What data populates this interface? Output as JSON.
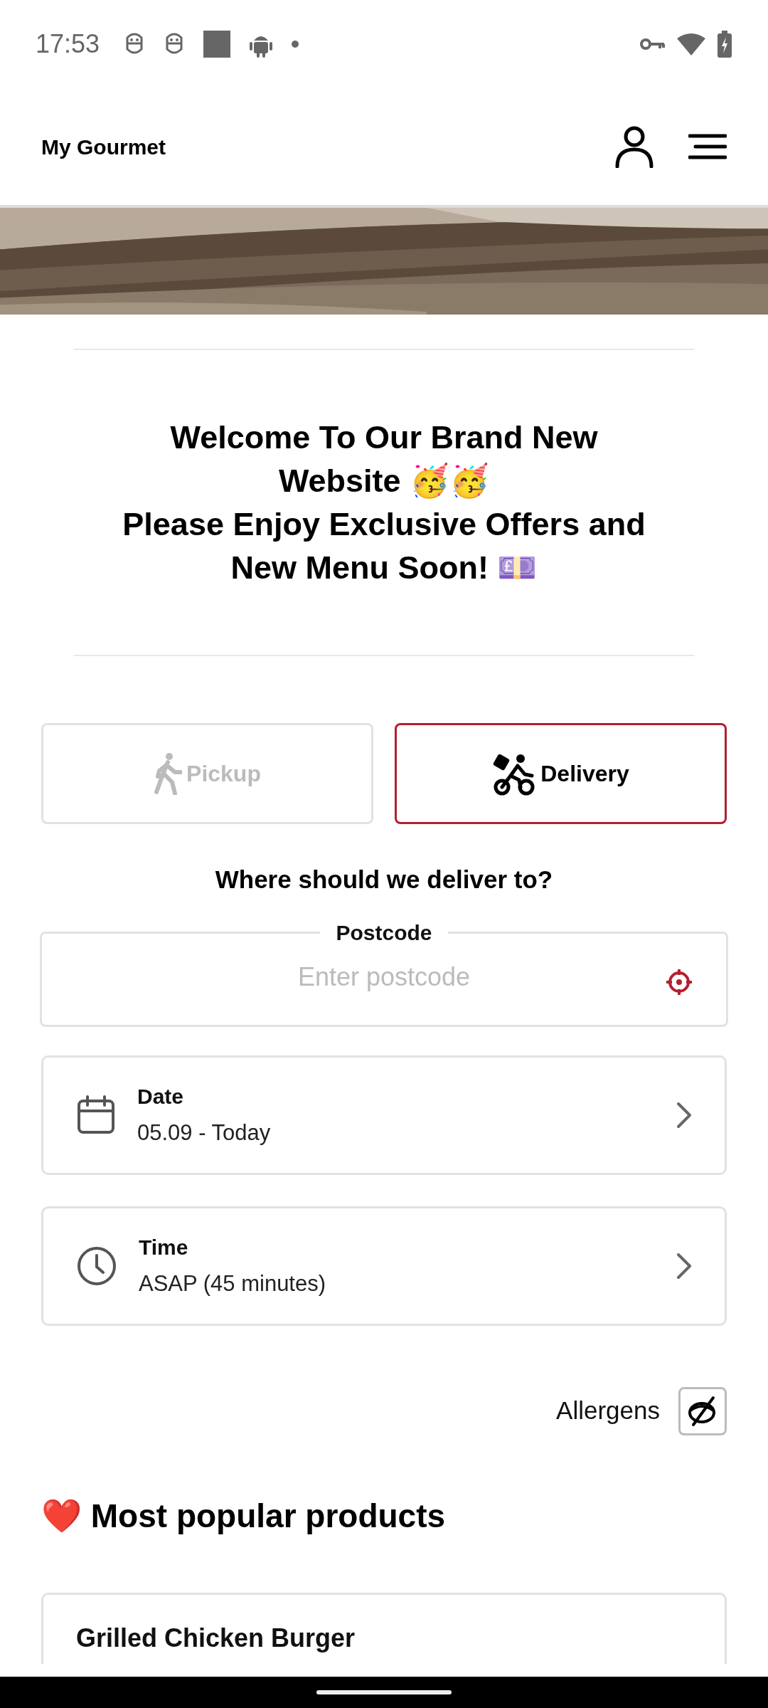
{
  "status_bar": {
    "time": "17:53"
  },
  "header": {
    "title": "My Gourmet"
  },
  "welcome": {
    "lines": [
      "Welcome To Our Brand New",
      "Website 🥳🥳",
      "Please Enjoy Exclusive Offers and",
      "New Menu Soon! 💷"
    ]
  },
  "order_modes": [
    {
      "label": "Pickup",
      "kind": "pickup",
      "selected": false
    },
    {
      "label": "Delivery",
      "kind": "delivery",
      "selected": true
    }
  ],
  "question": "Where should we deliver to?",
  "postcode": {
    "label": "Postcode",
    "placeholder": "Enter postcode"
  },
  "options": [
    {
      "kind": "date",
      "title": "Date",
      "value": "05.09 - Today"
    },
    {
      "kind": "time",
      "title": "Time",
      "value": "ASAP (45 minutes)"
    }
  ],
  "allergens": {
    "label": "Allergens"
  },
  "popular": {
    "title": "❤️ Most popular products",
    "products": [
      {
        "name": "Grilled Chicken Burger"
      }
    ]
  }
}
